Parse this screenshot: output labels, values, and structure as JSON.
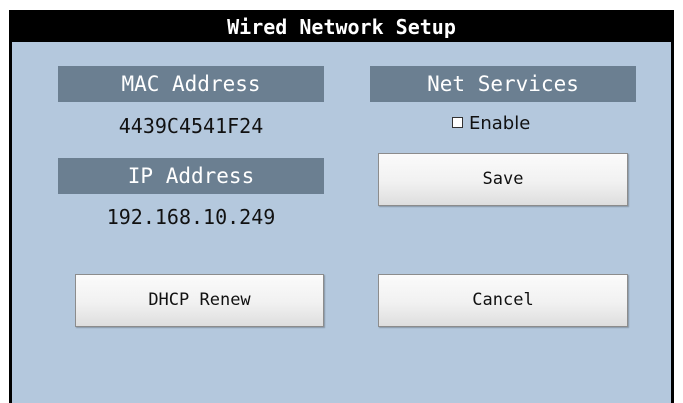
{
  "window": {
    "title": "Wired Network Setup"
  },
  "mac": {
    "label": "MAC Address",
    "value": "4439C4541F24"
  },
  "ip": {
    "label": "IP Address",
    "value": "192.168.10.249"
  },
  "net_services": {
    "label": "Net Services",
    "enable_label": "Enable",
    "enabled": false
  },
  "buttons": {
    "save": "Save",
    "dhcp_renew": "DHCP Renew",
    "cancel": "Cancel"
  },
  "colors": {
    "panel_bg": "#b4c8dd",
    "header_bg": "#6b7f91",
    "titlebar_bg": "#000000"
  }
}
